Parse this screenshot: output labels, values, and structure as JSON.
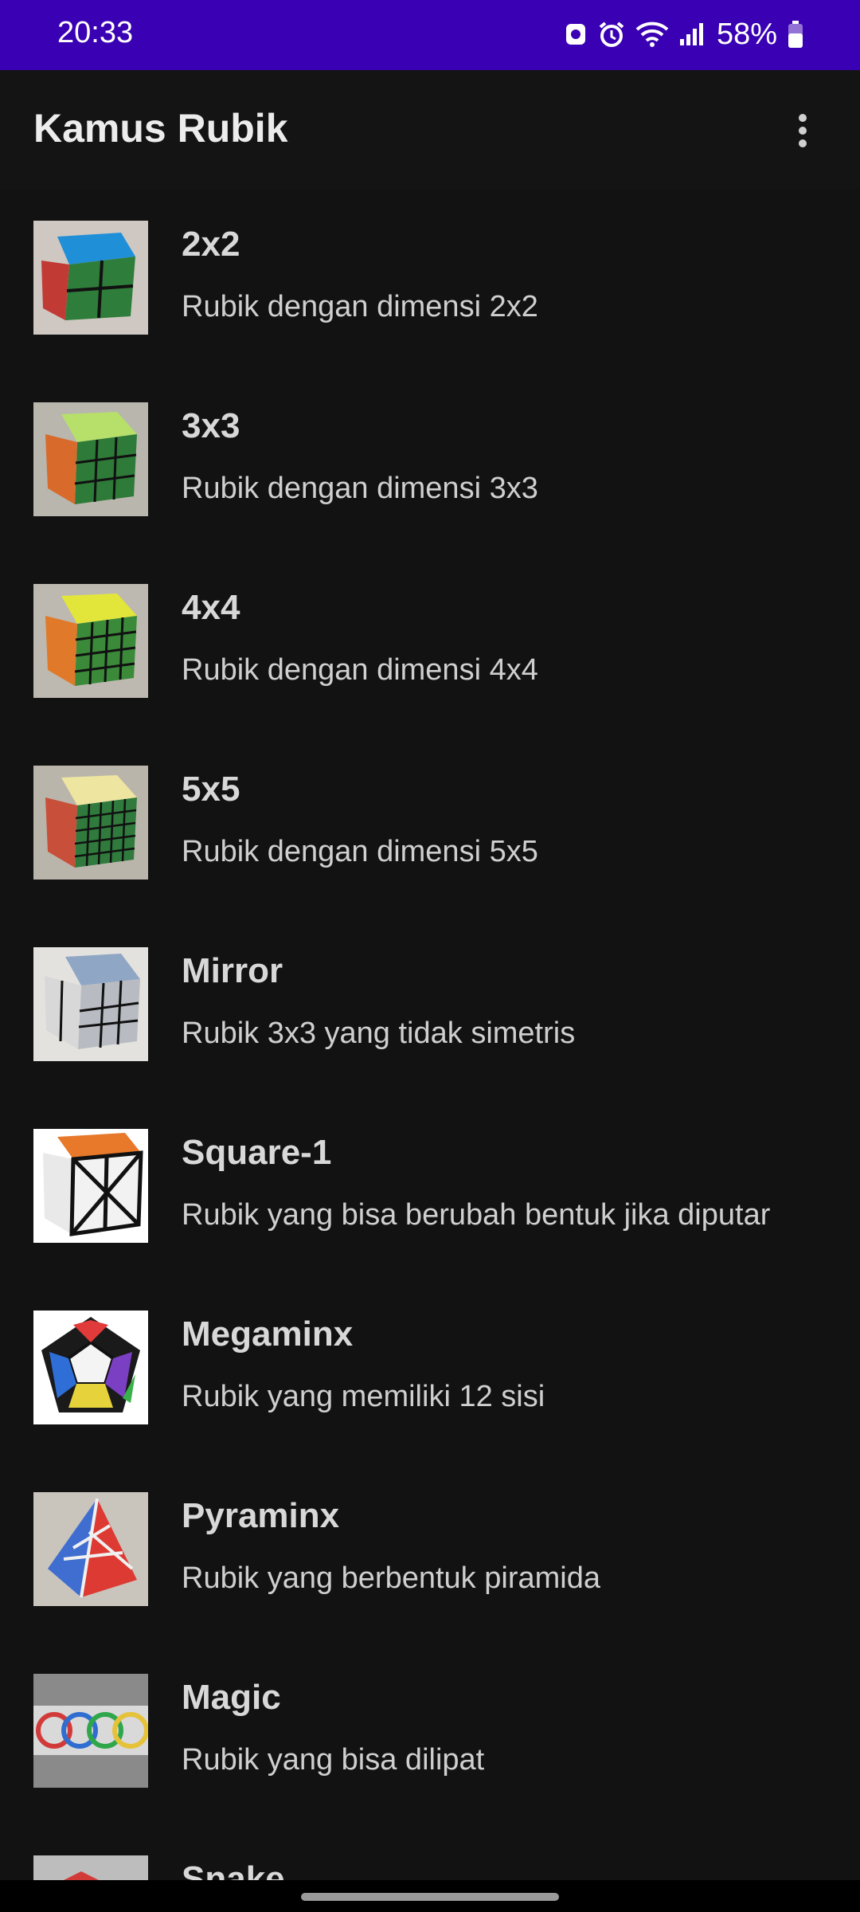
{
  "status_bar": {
    "time": "20:33",
    "battery": "58%",
    "icons": [
      "bixby-routine-icon",
      "alarm-icon",
      "wifi-icon",
      "signal-icon",
      "battery-icon"
    ]
  },
  "app_bar": {
    "title": "Kamus Rubik",
    "menu_icon": "more-vert-icon"
  },
  "items": [
    {
      "title": "2x2",
      "description": "Rubik dengan dimensi 2x2"
    },
    {
      "title": "3x3",
      "description": "Rubik dengan dimensi 3x3"
    },
    {
      "title": "4x4",
      "description": "Rubik dengan dimensi 4x4"
    },
    {
      "title": "5x5",
      "description": "Rubik dengan dimensi 5x5"
    },
    {
      "title": "Mirror",
      "description": "Rubik 3x3 yang tidak simetris"
    },
    {
      "title": "Square-1",
      "description": "Rubik yang bisa berubah bentuk jika diputar"
    },
    {
      "title": "Megaminx",
      "description": "Rubik yang memiliki 12 sisi"
    },
    {
      "title": "Pyraminx",
      "description": "Rubik yang berbentuk piramida"
    },
    {
      "title": "Magic",
      "description": "Rubik yang bisa dilipat"
    },
    {
      "title": "Snake",
      "description": ""
    }
  ],
  "colors": {
    "status_bar": "#3a00b3",
    "background": "#121212"
  }
}
